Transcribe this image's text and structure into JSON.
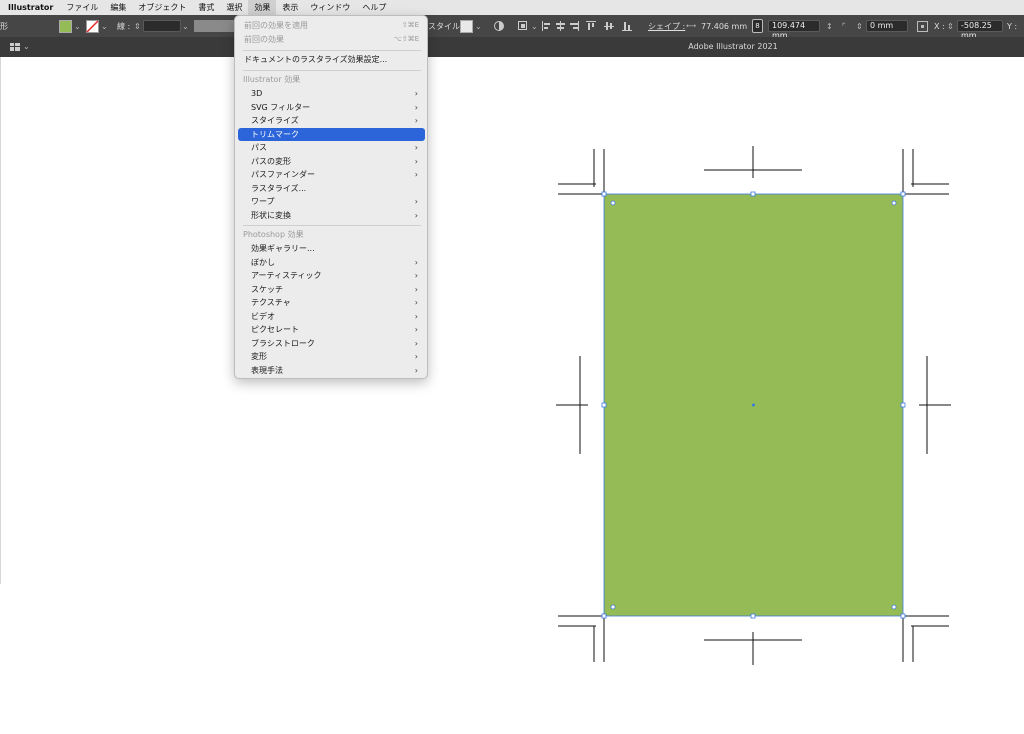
{
  "menubar": {
    "app": "Illustrator",
    "items": [
      "ファイル",
      "編集",
      "オブジェクト",
      "書式",
      "選択",
      "効果",
      "表示",
      "ウィンドウ",
      "ヘルプ"
    ],
    "active_index": 5
  },
  "control": {
    "left_label": "形",
    "fill_color": "#94bb55",
    "stroke_label": "線 :",
    "style_label": "スタイル :",
    "shape_label": "シェイプ :",
    "width": "77.406 mm",
    "height": "109.474 mm",
    "corner": "0 mm",
    "x_label": "X :",
    "x_value": "-508.25 mm",
    "y_label": "Y :"
  },
  "titlebar": {
    "title": "Adobe Illustrator 2021"
  },
  "menu": {
    "top_items": [
      {
        "label": "前回の効果を適用",
        "shortcut": "⇧⌘E"
      },
      {
        "label": "前回の効果",
        "shortcut": "⌥⇧⌘E"
      }
    ],
    "doc_item": "ドキュメントのラスタライズ効果設定...",
    "illustrator_header": "Illustrator 効果",
    "illustrator_items": [
      {
        "label": "3D",
        "sub": true
      },
      {
        "label": "SVG フィルター",
        "sub": true
      },
      {
        "label": "スタイライズ",
        "sub": true
      },
      {
        "label": "トリムマーク",
        "sub": false
      },
      {
        "label": "パス",
        "sub": true
      },
      {
        "label": "パスの変形",
        "sub": true
      },
      {
        "label": "パスファインダー",
        "sub": true
      },
      {
        "label": "ラスタライズ...",
        "sub": false
      },
      {
        "label": "ワープ",
        "sub": true
      },
      {
        "label": "形状に変換",
        "sub": true
      }
    ],
    "highlighted": "トリムマーク",
    "photoshop_header": "Photoshop 効果",
    "photoshop_items": [
      {
        "label": "効果ギャラリー...",
        "sub": false
      },
      {
        "label": "ぼかし",
        "sub": true
      },
      {
        "label": "アーティスティック",
        "sub": true
      },
      {
        "label": "スケッチ",
        "sub": true
      },
      {
        "label": "テクスチャ",
        "sub": true
      },
      {
        "label": "ビデオ",
        "sub": true
      },
      {
        "label": "ピクセレート",
        "sub": true
      },
      {
        "label": "ブラシストローク",
        "sub": true
      },
      {
        "label": "変形",
        "sub": true
      },
      {
        "label": "表現手法",
        "sub": true
      }
    ]
  },
  "colors": {
    "rect_fill": "#94bb55",
    "selection": "#3d7ae0",
    "highlight": "#2c64d9"
  }
}
